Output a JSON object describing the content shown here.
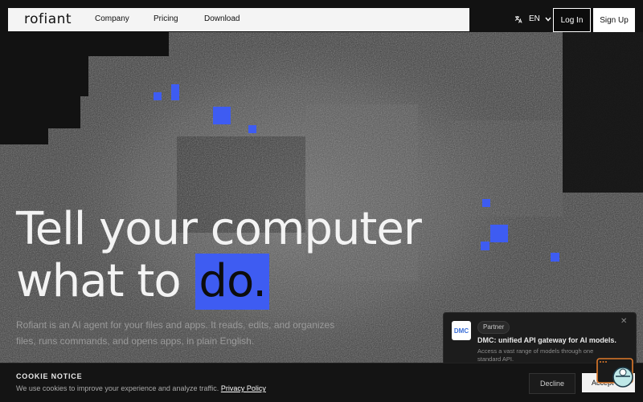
{
  "nav": {
    "logo": "rofiant",
    "links": [
      "Company",
      "Pricing",
      "Download"
    ],
    "language": "EN",
    "login_label": "Log In",
    "signup_label": "Sign Up"
  },
  "hero": {
    "headline_line1": "Tell your computer",
    "headline_line2_prefix": "what to",
    "headline_highlight": "do.",
    "subtext": "Rofiant is an AI agent for your files and apps. It reads, edits, and organizes files, runs commands, and opens apps, in plain English.",
    "accent_color": "#3e5cf2"
  },
  "partner_popup": {
    "logo_text": "DMC",
    "badge": "Partner",
    "title": "DMC: unified API gateway for AI models.",
    "description": "Access a vast range of models through one standard API.",
    "close_icon": "close-icon"
  },
  "cookie": {
    "title": "COOKIE NOTICE",
    "text": "We use cookies to improve your experience and analyze traffic.",
    "link_label": "Privacy Policy",
    "decline_label": "Decline",
    "accept_label": "Accept"
  },
  "icons": {
    "translate": "translate-icon",
    "chevron": "chevron-down-icon",
    "chat": "chat-widget-icon"
  }
}
